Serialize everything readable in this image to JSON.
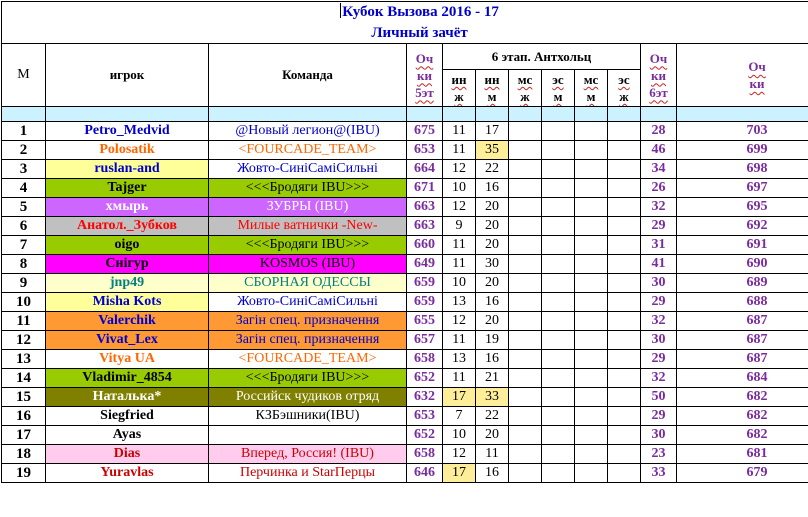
{
  "title": "Кубок Вызова 2016 - 17",
  "subtitle": "Личный зачёт",
  "headers": {
    "m": "М",
    "player": "игрок",
    "team": "Команда",
    "ochki5_top": "Оч",
    "ochki5_mid": "ки",
    "ochki5_bot": "5эт",
    "stage": "6 этап. Антхольц",
    "stage_cols": [
      {
        "top": "ин",
        "bot": "ж"
      },
      {
        "top": "ин",
        "bot": "м"
      },
      {
        "top": "мс",
        "bot": "ж"
      },
      {
        "top": "эс",
        "bot": "м"
      },
      {
        "top": "мс",
        "bot": "м"
      },
      {
        "top": "эс",
        "bot": "ж"
      }
    ],
    "ochki6_top": "Оч",
    "ochki6_mid": "ки",
    "ochki6_bot": "6эт",
    "total_top": "Оч",
    "total_bot": "ки"
  },
  "colors": {
    "blue_text": "#0000cc",
    "purple_points": "#7a2c9e",
    "highlight_yellow": "#ffee99",
    "spacer_cyan": "#ccf2ff"
  },
  "rows": [
    {
      "n": "1",
      "player": "Petro_Medvid",
      "team": "@Новый легион@(IBU)",
      "s5": "675",
      "a": "11",
      "b": "17",
      "st": "28",
      "tot": "703",
      "pc": "#0000cc",
      "tc": "#0000cc",
      "pbg": "#ffffff",
      "tbg": "#ffffff",
      "bhl": false,
      "ahl": false
    },
    {
      "n": "2",
      "player": "Polosatik",
      "team": "<FOURCADE_TEAM>",
      "s5": "653",
      "a": "11",
      "b": "35",
      "st": "46",
      "tot": "699",
      "pc": "#ff6600",
      "tc": "#ff6600",
      "pbg": "#ffffff",
      "tbg": "#ffffff",
      "bhl": true,
      "ahl": false
    },
    {
      "n": "3",
      "player": "ruslan-and",
      "team": "Жовто-СиніСаміСильні",
      "s5": "664",
      "a": "12",
      "b": "22",
      "st": "34",
      "tot": "698",
      "pc": "#0000cc",
      "tc": "#0000cc",
      "pbg": "#ffff99",
      "tbg": "#ffffff",
      "bhl": false,
      "ahl": false
    },
    {
      "n": "4",
      "player": "Tajger",
      "team": "<<<Бродяги IBU>>>",
      "s5": "671",
      "a": "10",
      "b": "16",
      "st": "26",
      "tot": "697",
      "pc": "#000000",
      "tc": "#000000",
      "pbg": "#99cc00",
      "tbg": "#99cc00",
      "bhl": false,
      "ahl": false
    },
    {
      "n": "5",
      "player": "хмырь",
      "team": "ЗУБРЫ (IBU)",
      "s5": "663",
      "a": "12",
      "b": "20",
      "st": "32",
      "tot": "695",
      "pc": "#ffffff",
      "tc": "#ffffff",
      "pbg": "#cc66ff",
      "tbg": "#cc66ff",
      "bhl": false,
      "ahl": false
    },
    {
      "n": "6",
      "player": "Анатол._Зубков",
      "team": "Милые ватнички -New-",
      "s5": "663",
      "a": "9",
      "b": "20",
      "st": "29",
      "tot": "692",
      "pc": "#ff0000",
      "tc": "#ff0000",
      "pbg": "#c0c0c0",
      "tbg": "#c0c0c0",
      "bhl": false,
      "ahl": false
    },
    {
      "n": "7",
      "player": "oigo",
      "team": "<<<Бродяги IBU>>>",
      "s5": "660",
      "a": "11",
      "b": "20",
      "st": "31",
      "tot": "691",
      "pc": "#000000",
      "tc": "#000000",
      "pbg": "#99cc00",
      "tbg": "#99cc00",
      "bhl": false,
      "ahl": false
    },
    {
      "n": "8",
      "player": "Cнiгур",
      "team": "KOSMOS (IBU)",
      "s5": "649",
      "a": "11",
      "b": "30",
      "st": "41",
      "tot": "690",
      "pc": "#000000",
      "tc": "#000000",
      "pbg": "#ff00ff",
      "tbg": "#ff00ff",
      "bhl": false,
      "ahl": false
    },
    {
      "n": "9",
      "player": "jnp49",
      "team": "СБОРНАЯ ОДЕССЫ",
      "s5": "659",
      "a": "10",
      "b": "20",
      "st": "30",
      "tot": "689",
      "pc": "#008080",
      "tc": "#008080",
      "pbg": "#ffffcc",
      "tbg": "#ffffcc",
      "bhl": false,
      "ahl": false
    },
    {
      "n": "10",
      "player": "Misha Kots",
      "team": "Жовто-СиніСаміСильні",
      "s5": "659",
      "a": "13",
      "b": "16",
      "st": "29",
      "tot": "688",
      "pc": "#0000cc",
      "tc": "#0000cc",
      "pbg": "#ffff99",
      "tbg": "#ffffff",
      "bhl": false,
      "ahl": false
    },
    {
      "n": "11",
      "player": "Valerchik",
      "team": "Загін спец. призначення",
      "s5": "655",
      "a": "12",
      "b": "20",
      "st": "32",
      "tot": "687",
      "pc": "#0000cc",
      "tc": "#0000cc",
      "pbg": "#ff9933",
      "tbg": "#ff9933",
      "bhl": false,
      "ahl": false
    },
    {
      "n": "12",
      "player": "Vivat_Lex",
      "team": "Загін спец. призначення",
      "s5": "657",
      "a": "11",
      "b": "19",
      "st": "30",
      "tot": "687",
      "pc": "#0000cc",
      "tc": "#0000cc",
      "pbg": "#ff9933",
      "tbg": "#ff9933",
      "bhl": false,
      "ahl": false
    },
    {
      "n": "13",
      "player": "Vitya UA",
      "team": "<FOURCADE_TEAM>",
      "s5": "658",
      "a": "13",
      "b": "16",
      "st": "29",
      "tot": "687",
      "pc": "#ff6600",
      "tc": "#ff6600",
      "pbg": "#ffffff",
      "tbg": "#ffffff",
      "bhl": false,
      "ahl": false
    },
    {
      "n": "14",
      "player": "Vladimir_4854",
      "team": "<<<Бродяги IBU>>>",
      "s5": "652",
      "a": "11",
      "b": "21",
      "st": "32",
      "tot": "684",
      "pc": "#000000",
      "tc": "#000000",
      "pbg": "#99cc00",
      "tbg": "#99cc00",
      "bhl": false,
      "ahl": false
    },
    {
      "n": "15",
      "player": "Наталька*",
      "team": "Российск чудиков отряд",
      "s5": "632",
      "a": "17",
      "b": "33",
      "st": "50",
      "tot": "682",
      "pc": "#ffffff",
      "tc": "#ffffff",
      "pbg": "#808000",
      "tbg": "#808000",
      "bhl": true,
      "ahl": true
    },
    {
      "n": "16",
      "player": "Siegfried",
      "team": "КЗБэшники(IBU)",
      "s5": "653",
      "a": "7",
      "b": "22",
      "st": "29",
      "tot": "682",
      "pc": "#000000",
      "tc": "#000000",
      "pbg": "#ffffff",
      "tbg": "#ffffff",
      "bhl": false,
      "ahl": false
    },
    {
      "n": "17",
      "player": "Ayas",
      "team": "",
      "s5": "652",
      "a": "10",
      "b": "20",
      "st": "30",
      "tot": "682",
      "pc": "#000000",
      "tc": "#000000",
      "pbg": "#ffffff",
      "tbg": "#ffffff",
      "bhl": false,
      "ahl": false
    },
    {
      "n": "18",
      "player": "Dias",
      "team": "Вперед, Россия! (IBU)",
      "s5": "658",
      "a": "12",
      "b": "11",
      "st": "23",
      "tot": "681",
      "pc": "#cc0000",
      "tc": "#cc0000",
      "pbg": "#ffccee",
      "tbg": "#ffccee",
      "bhl": false,
      "ahl": false
    },
    {
      "n": "19",
      "player": "Yuravlas",
      "team": "Перчинка и StarПерцы",
      "s5": "646",
      "a": "17",
      "b": "16",
      "st": "33",
      "tot": "679",
      "pc": "#cc0000",
      "tc": "#cc0000",
      "pbg": "#ffffff",
      "tbg": "#ffffff",
      "bhl": false,
      "ahl": true
    }
  ]
}
